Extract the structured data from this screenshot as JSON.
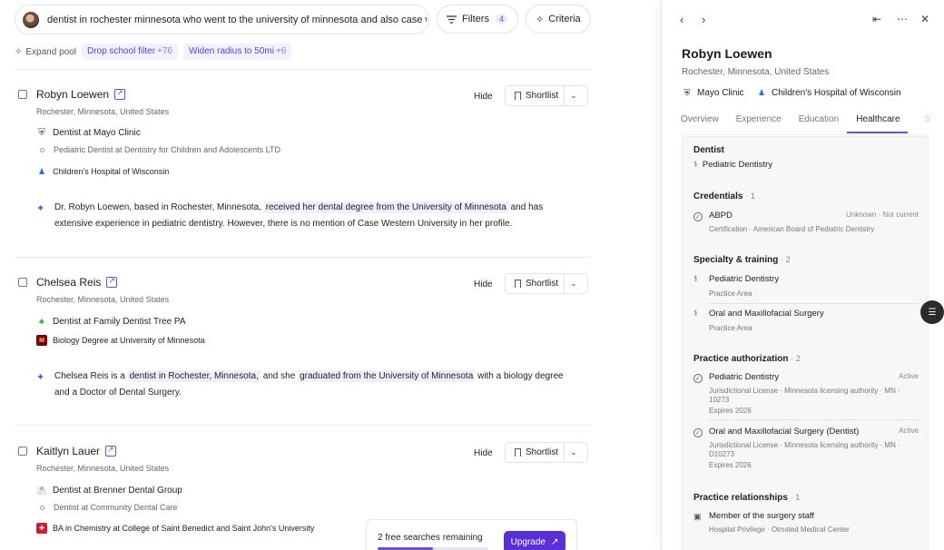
{
  "search": {
    "query": "dentist in rochester minnesota who went to the university of minnesota and also case western"
  },
  "filters": {
    "label": "Filters",
    "count": "4"
  },
  "criteria": {
    "label": "Criteria"
  },
  "expand": {
    "label": "Expand pool",
    "chips": [
      {
        "label": "Drop school filter",
        "count": "+76"
      },
      {
        "label": "Widen radius to 50mi",
        "count": "+6"
      }
    ]
  },
  "actions": {
    "hide": "Hide",
    "shortlist": "Shortlist"
  },
  "candidates": [
    {
      "name": "Robyn Loewen",
      "location": "Rochester, Minnesota, United States",
      "rows": [
        {
          "icon": "mayo-clinic-logo",
          "text": "Dentist at Mayo Clinic",
          "sub": false
        },
        {
          "icon": "dot",
          "text": "Pediatric Dentist at Dentistry for Children and Adolescents LTD",
          "sub": true
        },
        {
          "icon": "childrens-hospital-logo",
          "text": "Children's Hospital of Wisconsin",
          "sub": false
        }
      ],
      "summary": {
        "pre": "Dr. Robyn Loewen, based in Rochester, Minnesota,",
        "hl1": "received her dental degree from the University of Minnesota",
        "mid": "and has extensive experience in pediatric dentistry. However, there is no mention of Case Western University in her profile.",
        "hl2": "",
        "post": ""
      }
    },
    {
      "name": "Chelsea Reis",
      "location": "Rochester, Minnesota, United States",
      "rows": [
        {
          "icon": "tree-logo",
          "text": "Dentist at Family Dentist Tree PA",
          "sub": false
        },
        {
          "icon": "umn-logo",
          "text": "Biology Degree at University of Minnesota",
          "sub": false
        }
      ],
      "summary": {
        "pre": "Chelsea Reis is a",
        "hl1": "dentist in Rochester, Minnesota,",
        "mid": "and she",
        "hl2": "graduated from the University of Minnesota",
        "post": "with a biology degree and a Doctor of Dental Surgery."
      }
    },
    {
      "name": "Kaitlyn Lauer",
      "location": "Rochester, Minnesota, United States",
      "rows": [
        {
          "icon": "brenner-logo",
          "text": "Dentist at Brenner Dental Group",
          "sub": false
        },
        {
          "icon": "dot",
          "text": "Dentist at Community Dental Care",
          "sub": true
        },
        {
          "icon": "csb-logo",
          "text": "BA in Chemistry at College of Saint Benedict and Saint John's University",
          "sub": false
        }
      ]
    }
  ],
  "upgrade": {
    "text": "2 free searches remaining",
    "button": "Upgrade",
    "progress": 0.5
  },
  "panel": {
    "name": "Robyn Loewen",
    "location": "Rochester, Minnesota, United States",
    "orgs": [
      "Mayo Clinic",
      "Children's Hospital of Wisconsin"
    ],
    "tabs": [
      "Overview",
      "Experience",
      "Education",
      "Healthcare",
      "S"
    ],
    "active_tab": "Healthcare",
    "role": {
      "title": "Dentist",
      "specialty": "Pediatric Dentistry"
    },
    "credentials": {
      "title": "Credentials",
      "count": "· 1",
      "items": [
        {
          "name": "ABPD",
          "status": "Unknown · Not current",
          "sub": "Certification · American Board of Pediatric Dentistry"
        }
      ]
    },
    "specialty": {
      "title": "Specialty & training",
      "count": "· 2",
      "items": [
        {
          "name": "Pediatric Dentistry",
          "sub": "Practice Area"
        },
        {
          "name": "Oral and Maxillofacial Surgery",
          "sub": "Practice Area"
        }
      ]
    },
    "authorization": {
      "title": "Practice authorization",
      "count": "· 2",
      "items": [
        {
          "name": "Pediatric Dentistry",
          "status": "Active",
          "sub1": "Jurisdictional License · Minnesota licensing authority · MN ·",
          "sub2": "10273",
          "sub3": "Expires 2026"
        },
        {
          "name": "Oral and Maxillofacial Surgery (Dentist)",
          "status": "Active",
          "sub1": "Jurisdictional License · Minnesota licensing authority · MN ·",
          "sub2": "D10273",
          "sub3": "Expires 2026"
        }
      ]
    },
    "relationships": {
      "title": "Practice relationships",
      "count": "· 1",
      "items": [
        {
          "name": "Member of the surgery staff",
          "sub": "Hospital Privilege · Olmsted Medical Center"
        }
      ]
    }
  }
}
